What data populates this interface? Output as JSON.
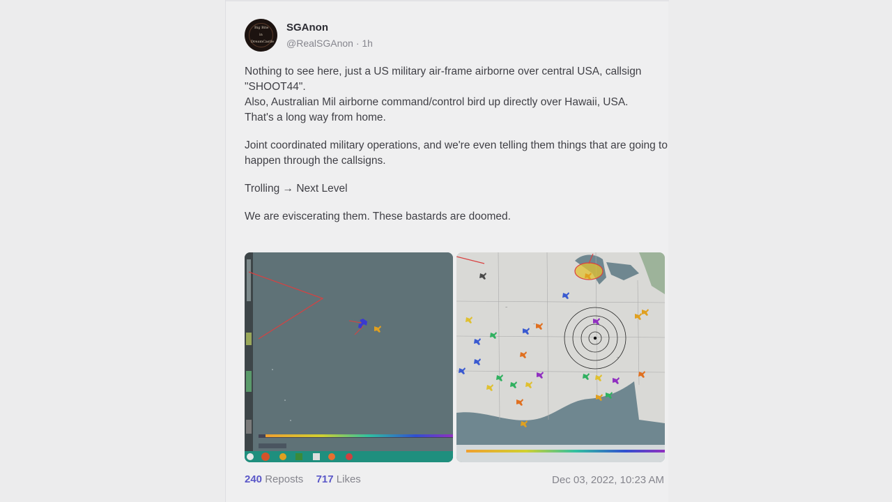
{
  "post": {
    "author_name": "SGAnon",
    "author_handle": "@RealSGAnon",
    "time_ago": "1h",
    "avatar_text": [
      "Big Bite",
      "in",
      "DreamCastle"
    ],
    "paragraphs": [
      [
        "Nothing to see here, just a US military air-frame airborne over central USA, callsign \"SHOOT44\".",
        "Also, Australian Mil airborne command/control bird up directly over Hawaii, USA.",
        "That's a long way from home."
      ],
      [
        "Joint coordinated military operations, and we're even telling them things that are going to happen through the callsigns."
      ],
      [
        "Trolling → Next Level"
      ],
      [
        "We are eviscerating them. These bastards are doomed."
      ]
    ],
    "media": [
      {
        "icon": "flight-tracker-map-hawaii"
      },
      {
        "icon": "flight-tracker-map-usa"
      }
    ],
    "reposts_count": "240",
    "reposts_label": "Reposts",
    "likes_count": "717",
    "likes_label": "Likes",
    "timestamp": "Dec 03, 2022, 10:23 AM"
  },
  "colors": {
    "accent": "#5a57c8",
    "muted": "#85858d",
    "page_bg": "#ececed",
    "card_bg": "#efeff0"
  }
}
